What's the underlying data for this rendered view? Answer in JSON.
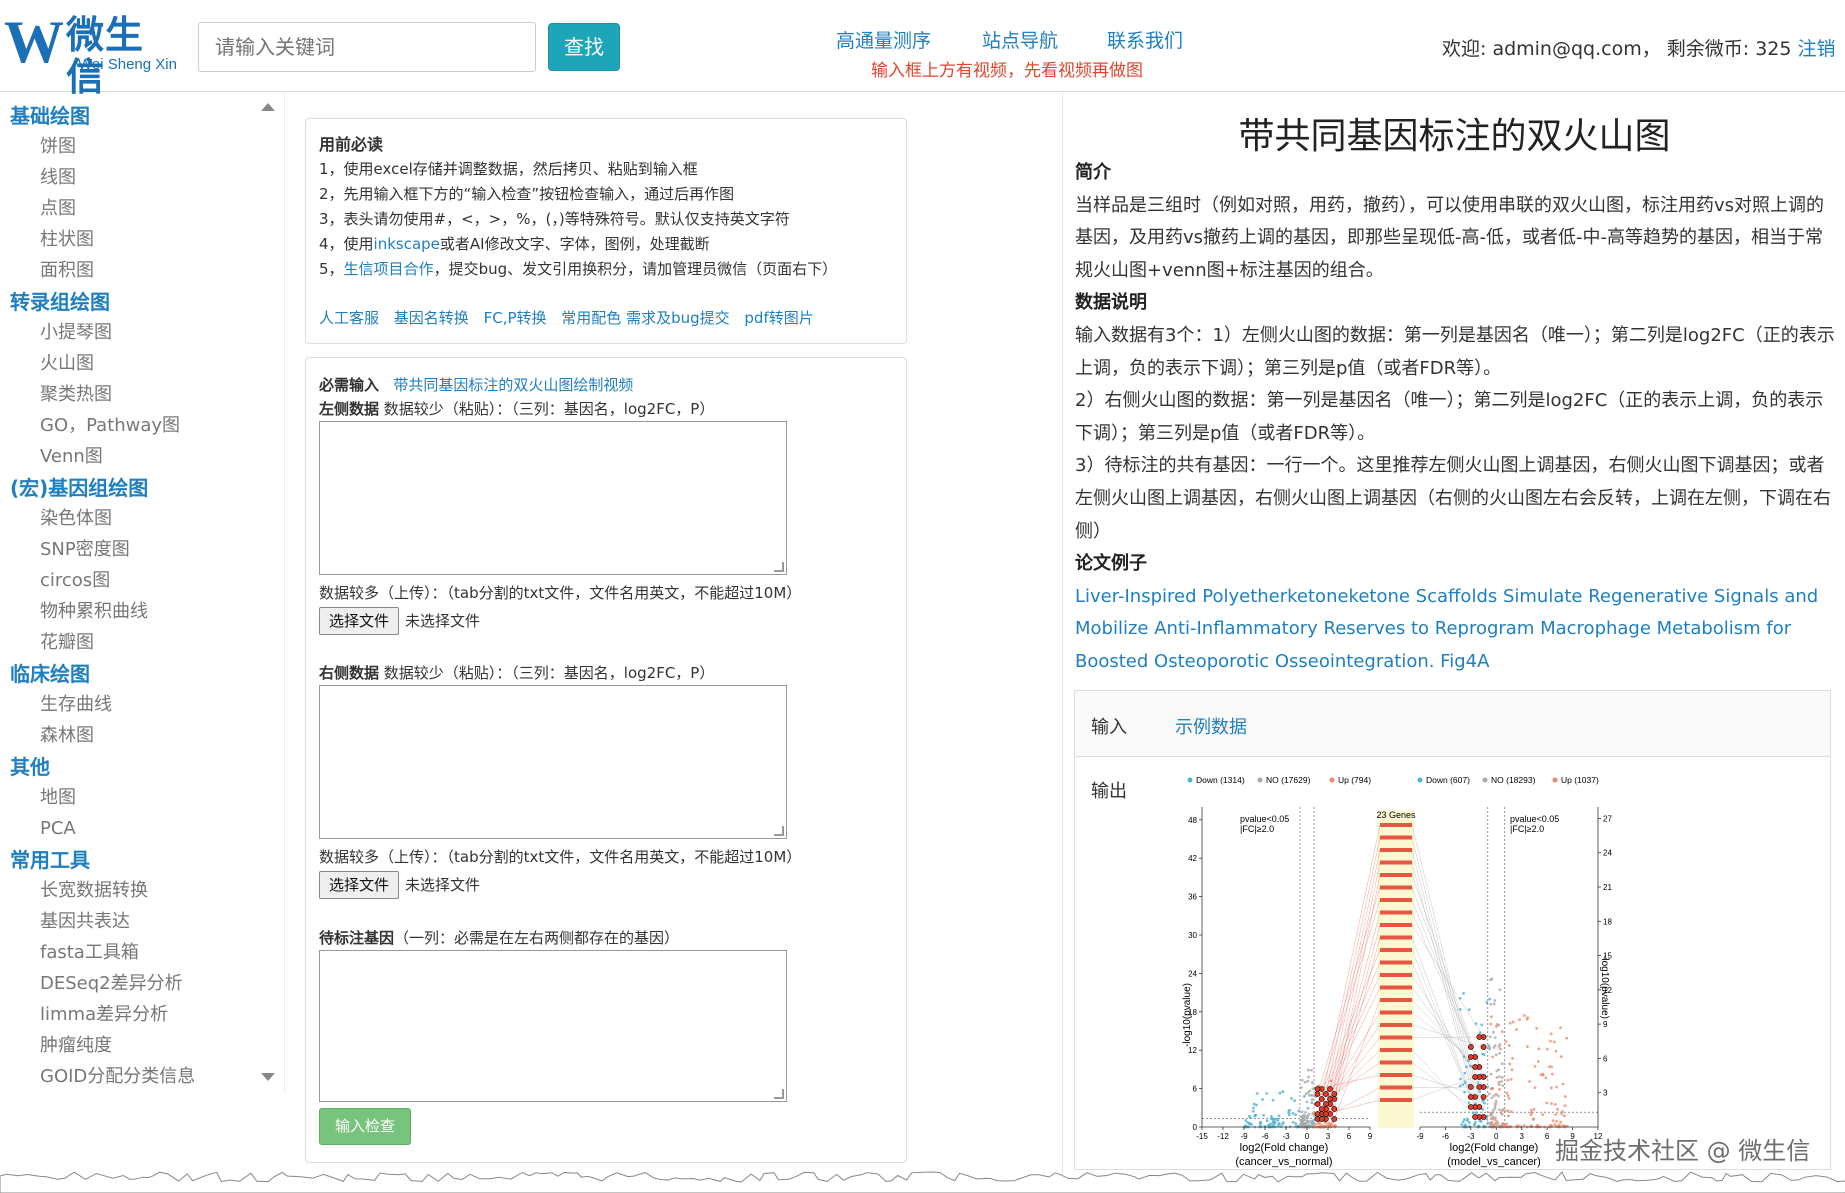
{
  "header": {
    "logo_cn": "微生信",
    "logo_en": "Wei Sheng Xin",
    "search_placeholder": "请输入关键词",
    "search_button": "查找",
    "nav": [
      "高通量测序",
      "站点导航",
      "联系我们"
    ],
    "notice": "输入框上方有视频，先看视频再做图",
    "welcome": "欢迎: admin@qq.com， 剩余微币: 325 ",
    "logout": "注销"
  },
  "sidebar": {
    "sections": [
      {
        "title": "基础绘图",
        "items": [
          "饼图",
          "线图",
          "点图",
          "柱状图",
          "面积图"
        ]
      },
      {
        "title": "转录组绘图",
        "items": [
          "小提琴图",
          "火山图",
          "聚类热图",
          "GO，Pathway图",
          "Venn图"
        ]
      },
      {
        "title": "(宏)基因组绘图",
        "items": [
          "染色体图",
          "SNP密度图",
          "circos图",
          "物种累积曲线",
          "花瓣图"
        ]
      },
      {
        "title": "临床绘图",
        "items": [
          "生存曲线",
          "森林图"
        ]
      },
      {
        "title": "其他",
        "items": [
          "地图",
          "PCA"
        ]
      },
      {
        "title": "常用工具",
        "items": [
          "长宽数据转换",
          "基因共表达",
          "fasta工具箱",
          "DESeq2差异分析",
          "limma差异分析",
          "肿瘤纯度",
          "GOID分配分类信息"
        ]
      }
    ]
  },
  "guide": {
    "title": "用前必读",
    "line1": "1，使用excel存储并调整数据，然后拷贝、粘贴到输入框",
    "line2": "2，先用输入框下方的“输入检查”按钮检查输入，通过后再作图",
    "line3": "3，表头请勿使用#，<，>，%，(，)等特殊符号。默认仅支持英文字符",
    "line4_a": "4，使用",
    "line4_link": "inkscape",
    "line4_b": "或者AI修改文字、字体，图例，处理截断",
    "line5_a": "5，",
    "line5_link": "生信项目合作",
    "line5_b": "，提交bug、发文引用换积分，请加管理员微信（页面右下）",
    "links": [
      "人工客服",
      "基因名转换",
      "FC,P转换",
      "常用配色 需求及bug提交",
      "pdf转图片"
    ]
  },
  "form": {
    "required_label": "必需输入",
    "video_link": "带共同基因标注的双火山图绘制视频",
    "left_label": "左侧数据",
    "left_hint": " 数据较少（粘贴）：（三列：基因名，log2FC，P）",
    "upload_hint": "数据较多（上传）：（tab分割的txt文件，文件名用英文，不能超过10M）",
    "choose_file": "选择文件",
    "no_file": "未选择文件",
    "right_label": "右侧数据",
    "right_hint": " 数据较少（粘贴）：（三列：基因名，log2FC，P）",
    "genes_label": "待标注基因",
    "genes_hint": "（一列：必需是在左右两侧都存在的基因）",
    "check_button": "输入检查"
  },
  "right_panel": {
    "title": "带共同基因标注的双火山图",
    "intro_head": "简介",
    "intro": "当样品是三组时（例如对照，用药，撤药），可以使用串联的双火山图，标注用药vs对照上调的基因，及用药vs撤药上调的基因，即那些呈现低-高-低，或者低-中-高等趋势的基因，相当于常规火山图+venn图+标注基因的组合。",
    "data_head": "数据说明",
    "data1": "输入数据有3个：1）左侧火山图的数据：第一列是基因名（唯一）；第二列是log2FC（正的表示上调，负的表示下调）；第三列是p值（或者FDR等）。",
    "data2": "2）右侧火山图的数据：第一列是基因名（唯一）；第二列是log2FC（正的表示上调，负的表示下调）；第三列是p值（或者FDR等）。",
    "data3": "3）待标注的共有基因：一行一个。这里推荐左侧火山图上调基因，右侧火山图下调基因；或者左侧火山图上调基因，右侧火山图上调基因（右侧的火山图左右会反转，上调在左侧，下调在右侧）",
    "paper_head": "论文例子",
    "paper_link": "Liver-Inspired Polyetherketoneketone Scaffolds Simulate Regenerative Signals and Mobilize Anti-Inflammatory Reserves to Reprogram Macrophage Metabolism for Boosted Osteoporotic Osseointegration. Fig4A",
    "input_label": "输入",
    "example_link": "示例数据",
    "output_label": "输出"
  },
  "plot": {
    "legend_left": [
      "Down (1314)",
      "NO (17629)",
      "Up (794)"
    ],
    "legend_right": [
      "Down (607)",
      "NO (18293)",
      "Up (1037)"
    ],
    "center_label": "23 Genes",
    "threshold_left": [
      "pvalue<0.05",
      "|FC|≥2.0"
    ],
    "threshold_right": [
      "pvalue<0.05",
      "|FC|≥2.0"
    ],
    "y_left_ticks": [
      "0",
      "6",
      "12",
      "18",
      "24",
      "30",
      "36",
      "42",
      "48"
    ],
    "y_right_ticks": [
      "3",
      "6",
      "9",
      "12",
      "15",
      "18",
      "21",
      "24",
      "27"
    ],
    "x_left_ticks": [
      "-15",
      "-12",
      "-9",
      "-6",
      "-3",
      "0",
      "3",
      "6",
      "9"
    ],
    "x_right_ticks": [
      "-9",
      "-6",
      "-3",
      "0",
      "3",
      "6",
      "9",
      "12"
    ],
    "y_label": "-log10(pvalue)",
    "x_left_label": "log2(Fold change)",
    "x_left_sub": "(cancer_vs_normal)",
    "x_right_label": "log2(Fold change)",
    "x_right_sub": "(model_vs_cancer)",
    "colors": {
      "down": "#4fb3d3",
      "no": "#a8a8a8",
      "up": "#f08a6c",
      "gene": "#e23a2a"
    }
  },
  "watermark": "掘金技术社区 @ 微生信"
}
